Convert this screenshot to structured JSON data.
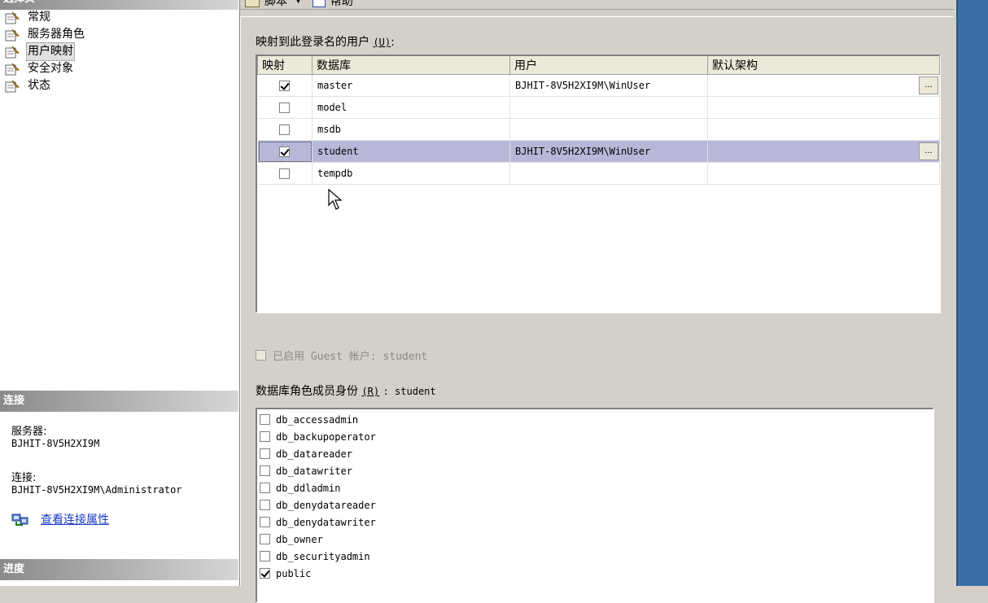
{
  "left": {
    "select_page_header": "选择页",
    "pages": [
      {
        "label": "常规",
        "selected": false
      },
      {
        "label": "服务器角色",
        "selected": false
      },
      {
        "label": "用户映射",
        "selected": true
      },
      {
        "label": "安全对象",
        "selected": false
      },
      {
        "label": "状态",
        "selected": false
      }
    ],
    "connection_header": "连接",
    "server_label": "服务器:",
    "server_value": "BJHIT-8V5H2XI9M",
    "connection_label": "连接:",
    "connection_value": "BJHIT-8V5H2XI9M\\Administrator",
    "view_connection_link": "查看连接属性",
    "progress_header": "进度"
  },
  "toolbar": {
    "script_label": "脚本",
    "help_label": "帮助"
  },
  "main": {
    "users_label": "映射到此登录名的用户",
    "users_hotkey": "(U)",
    "grid_headers": [
      "映射",
      "数据库",
      "用户",
      "默认架构"
    ],
    "rows": [
      {
        "mapped": true,
        "database": "master",
        "user": "BJHIT-8V5H2XI9M\\WinUser",
        "schema": "",
        "selected": false,
        "ellipsis": "..."
      },
      {
        "mapped": false,
        "database": "model",
        "user": "",
        "schema": "",
        "selected": false,
        "ellipsis": ""
      },
      {
        "mapped": false,
        "database": "msdb",
        "user": "",
        "schema": "",
        "selected": false,
        "ellipsis": ""
      },
      {
        "mapped": true,
        "database": "student",
        "user": "BJHIT-8V5H2XI9M\\WinUser",
        "schema": "",
        "selected": true,
        "ellipsis": "..."
      },
      {
        "mapped": false,
        "database": "tempdb",
        "user": "",
        "schema": "",
        "selected": false,
        "ellipsis": ""
      }
    ],
    "guest_label": "已启用 Guest 帐户: student",
    "guest_checked": false,
    "roles_label": "数据库角色成员身份",
    "roles_hotkey": "(R)",
    "roles_db": ": student",
    "roles": [
      {
        "name": "db_accessadmin",
        "checked": false
      },
      {
        "name": "db_backupoperator",
        "checked": false
      },
      {
        "name": "db_datareader",
        "checked": false
      },
      {
        "name": "db_datawriter",
        "checked": false
      },
      {
        "name": "db_ddladmin",
        "checked": false
      },
      {
        "name": "db_denydatareader",
        "checked": false
      },
      {
        "name": "db_denydatawriter",
        "checked": false
      },
      {
        "name": "db_owner",
        "checked": false
      },
      {
        "name": "db_securityadmin",
        "checked": false
      },
      {
        "name": "public",
        "checked": true
      }
    ]
  },
  "colors": {
    "selected_row": "#b7b8d8",
    "link": "#1a3cc6",
    "desktop_strip": "#3a6ea5"
  }
}
